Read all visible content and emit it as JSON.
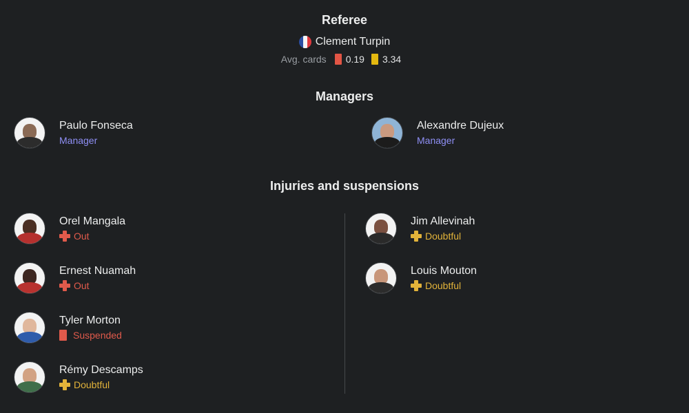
{
  "referee": {
    "title": "Referee",
    "name": "Clement Turpin",
    "flag": "france-flag",
    "avg_label": "Avg. cards",
    "red_avg": "0.19",
    "yellow_avg": "3.34"
  },
  "managers": {
    "title": "Managers",
    "home": {
      "name": "Paulo Fonseca",
      "role": "Manager"
    },
    "away": {
      "name": "Alexandre Dujeux",
      "role": "Manager"
    }
  },
  "injuries": {
    "title": "Injuries and suspensions",
    "home": [
      {
        "name": "Orel Mangala",
        "status": "Out"
      },
      {
        "name": "Ernest Nuamah",
        "status": "Out"
      },
      {
        "name": "Tyler Morton",
        "status": "Suspended"
      },
      {
        "name": "Rémy Descamps",
        "status": "Doubtful"
      }
    ],
    "away": [
      {
        "name": "Jim Allevinah",
        "status": "Doubtful"
      },
      {
        "name": "Louis Mouton",
        "status": "Doubtful"
      }
    ]
  },
  "colors": {
    "background": "#1e2022",
    "manager_role": "#8f8ff5",
    "out": "#e05a4b",
    "doubtful": "#e2b33a",
    "red_card": "#e25545",
    "yellow_card": "#e3b810"
  }
}
